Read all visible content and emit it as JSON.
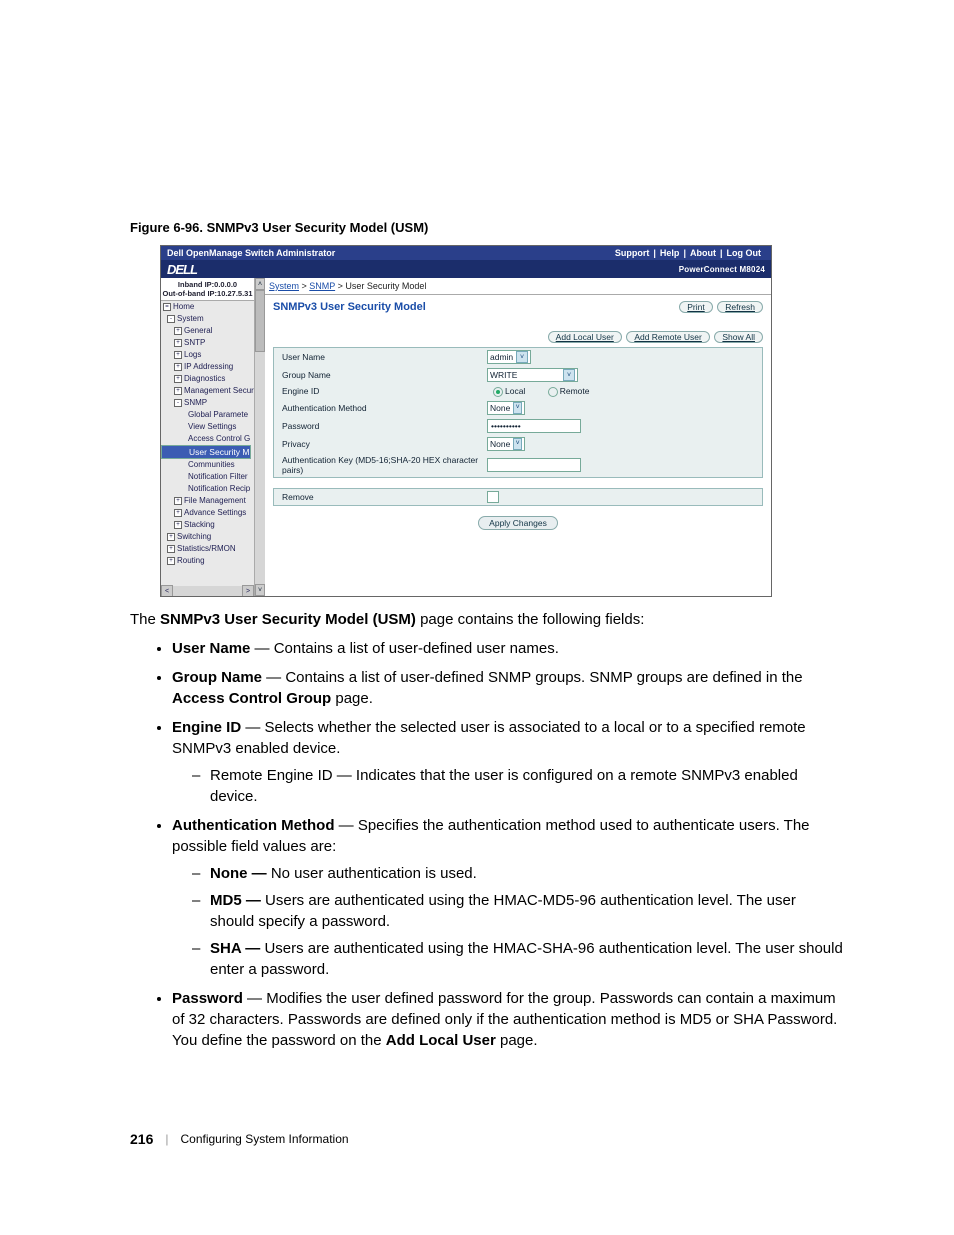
{
  "figure_caption": "Figure 6-96.    SNMPv3 User Security Model (USM)",
  "topbar": {
    "title": "Dell OpenManage Switch Administrator",
    "links": [
      "Support",
      "Help",
      "About",
      "Log Out"
    ]
  },
  "brand": {
    "logo": "DELL",
    "model": "PowerConnect M8024"
  },
  "ipbox": {
    "line1": "Inband IP:0.0.0.0",
    "line2": "Out-of-band IP:10.27.5.31"
  },
  "tree": {
    "home": "Home",
    "system": "System",
    "general": "General",
    "sntp": "SNTP",
    "logs": "Logs",
    "ip": "IP Addressing",
    "diag": "Diagnostics",
    "mgmt": "Management Secur",
    "snmp": "SNMP",
    "global": "Global Paramete",
    "view": "View Settings",
    "access": "Access Control G",
    "usm": "User Security M",
    "comm": "Communities",
    "notif_filter": "Notification Filter",
    "notif_recip": "Notification Recip",
    "filemgmt": "File Management",
    "advance": "Advance Settings",
    "stacking": "Stacking",
    "switching": "Switching",
    "stats": "Statistics/RMON",
    "routing": "Routing"
  },
  "breadcrumb": {
    "a": "System",
    "b": "SNMP",
    "c": "User Security Model"
  },
  "panel": {
    "title": "SNMPv3 User Security Model",
    "print": "Print",
    "refresh": "Refresh",
    "add_local": "Add Local User",
    "add_remote": "Add Remote User",
    "show_all": "Show All"
  },
  "form": {
    "user_name_lbl": "User Name",
    "user_name_val": "admin",
    "group_name_lbl": "Group Name",
    "group_name_val": "WRITE",
    "engine_lbl": "Engine ID",
    "engine_local": "Local",
    "engine_remote": "Remote",
    "auth_lbl": "Authentication Method",
    "auth_val": "None",
    "password_lbl": "Password",
    "password_val": "••••••••••",
    "privacy_lbl": "Privacy",
    "privacy_val": "None",
    "authkey_lbl": "Authentication Key (MD5-16;SHA-20 HEX character pairs)",
    "remove_lbl": "Remove",
    "apply": "Apply Changes"
  },
  "intro": {
    "pre": "The ",
    "bold": "SNMPv3 User Security Model (USM)",
    "post": " page contains the following fields:"
  },
  "bullets": {
    "b1": {
      "t": "User Name",
      "d": " — Contains a list of user-defined user names."
    },
    "b2": {
      "t": "Group Name",
      "d1": " — Contains a list of user-defined SNMP groups. SNMP groups are defined in the ",
      "t2": "Access Control Group",
      "d2": " page."
    },
    "b3": {
      "t": "Engine ID",
      "d": " — Selects whether the selected user is associated to a local or to a specified remote SNMPv3 enabled device.",
      "sub": "Remote Engine ID — Indicates that the user is configured on a remote SNMPv3 enabled device."
    },
    "b4": {
      "t": "Authentication Method",
      "d": " — Specifies the authentication method used to authenticate users. The possible field values are:",
      "s1": {
        "t": "None — ",
        "d": "No user authentication is used."
      },
      "s2": {
        "t": "MD5 — ",
        "d": "Users are authenticated using the HMAC-MD5-96 authentication level. The user should specify a password."
      },
      "s3": {
        "t": "SHA — ",
        "d": "Users are authenticated using the HMAC-SHA-96 authentication level. The user should enter a password."
      }
    },
    "b5": {
      "t": "Password",
      "d1": " — Modifies the user defined password for the group. Passwords can contain a maximum of 32 characters. Passwords are defined only if the authentication method is MD5 or SHA Password. You define the password on the ",
      "t2": "Add Local User",
      "d2": " page."
    }
  },
  "footer": {
    "page": "216",
    "section": "Configuring System Information"
  }
}
